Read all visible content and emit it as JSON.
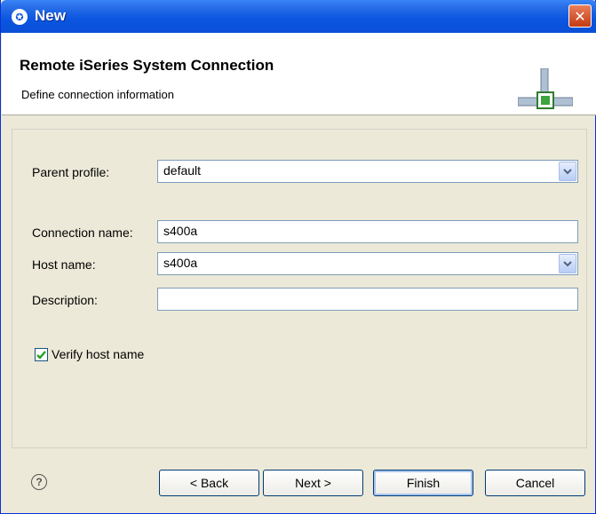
{
  "window": {
    "title": "New"
  },
  "banner": {
    "heading": "Remote iSeries System Connection",
    "subheading": "Define connection information"
  },
  "form": {
    "parent_profile_label": "Parent profile:",
    "parent_profile_value": "default",
    "connection_name_label": "Connection name:",
    "connection_name_value": "s400a",
    "host_name_label": "Host name:",
    "host_name_value": "s400a",
    "description_label": "Description:",
    "description_value": "",
    "verify_label": "Verify host name",
    "verify_checked": true
  },
  "buttons": {
    "back": "< Back",
    "next": "Next >",
    "finish": "Finish",
    "cancel": "Cancel"
  },
  "icons": {
    "app": "eclipse-icon",
    "close": "close-icon",
    "help": "help-icon",
    "banner": "connection-icon",
    "dropdown": "chevron-down-icon"
  },
  "colors": {
    "titlebar": "#0A55E0",
    "close": "#D5532A",
    "dialog_bg": "#ECE9D8"
  }
}
